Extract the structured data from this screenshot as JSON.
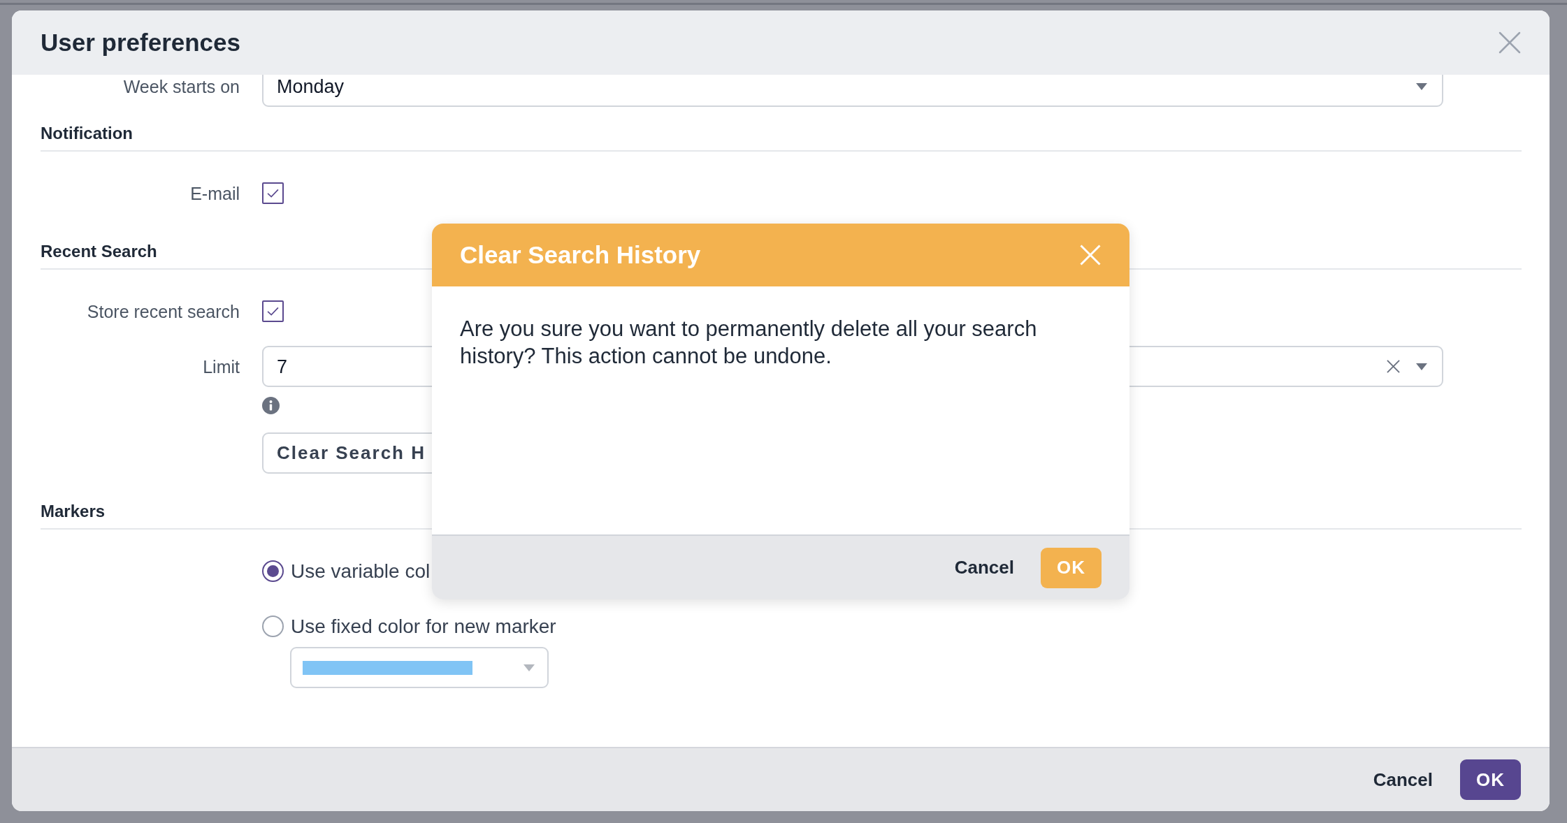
{
  "window": {
    "title": "User preferences"
  },
  "sections": [
    {
      "rows": [
        {
          "kind": "select",
          "label": "Week starts on",
          "value": "Monday"
        }
      ]
    },
    {
      "title": "Notification",
      "rows": [
        {
          "kind": "checkbox",
          "label": "E-mail",
          "checked": true
        }
      ]
    },
    {
      "title": "Recent Search",
      "rows": [
        {
          "kind": "checkbox",
          "label": "Store recent search",
          "checked": true
        },
        {
          "kind": "select",
          "label": "Limit",
          "value": "7",
          "clearable": true
        },
        {
          "kind": "info"
        },
        {
          "kind": "button",
          "text": "Clear Search H"
        }
      ]
    },
    {
      "title": "Markers",
      "rows": [
        {
          "kind": "radio",
          "text": "Use variable col",
          "selected": true
        },
        {
          "kind": "radio",
          "text": "Use fixed color for new marker",
          "selected": false
        },
        {
          "kind": "color",
          "color": "#80c4f5"
        }
      ]
    }
  ],
  "footer": {
    "buttons": [
      {
        "kind": "text",
        "label": "Cancel"
      },
      {
        "kind": "primary",
        "label": "OK"
      }
    ]
  },
  "confirm_dialog": {
    "title": "Clear Search History",
    "message": "Are you sure you want to permanently delete all your search history? This action cannot be undone.",
    "buttons": [
      {
        "kind": "text",
        "label": "Cancel"
      },
      {
        "kind": "warning",
        "label": "OK"
      }
    ]
  }
}
